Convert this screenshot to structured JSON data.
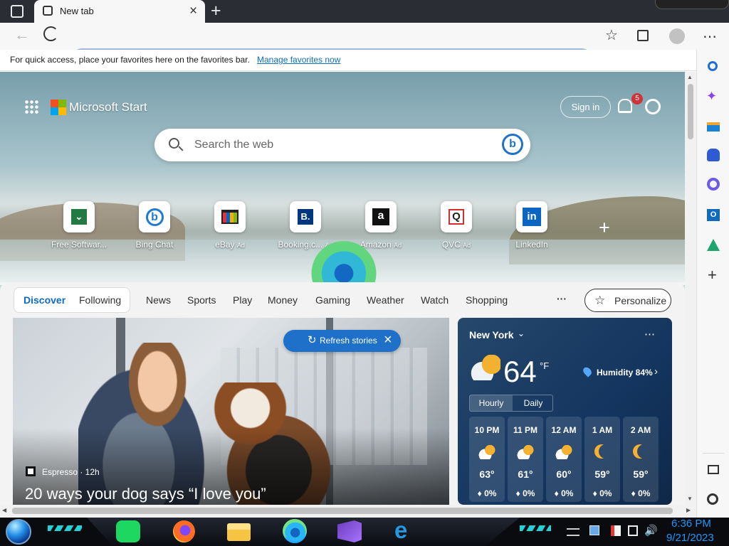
{
  "browser": {
    "tab_title": "New tab",
    "address_value": "",
    "favorites_message": "For quick access, place your favorites here on the favorites bar.",
    "manage_favorites": "Manage favorites now"
  },
  "start": {
    "brand": "Microsoft Start",
    "sign_in": "Sign in",
    "notifications": "5",
    "search_placeholder": "Search the web"
  },
  "shortcuts": [
    {
      "label": "Free Softwar...",
      "ad": "",
      "icon": "free-software-icon"
    },
    {
      "label": "Bing Chat",
      "ad": "",
      "icon": "bing-chat-icon"
    },
    {
      "label": "eBay",
      "ad": "Ad",
      "icon": "ebay-icon"
    },
    {
      "label": "Booking.c...",
      "ad": "Ad",
      "icon": "booking-icon"
    },
    {
      "label": "Amazon",
      "ad": "Ad",
      "icon": "amazon-icon"
    },
    {
      "label": "QVC",
      "ad": "Ad",
      "icon": "qvc-icon"
    },
    {
      "label": "LinkedIn",
      "ad": "",
      "icon": "linkedin-icon"
    }
  ],
  "feed_nav": {
    "discover": "Discover",
    "following": "Following",
    "items": [
      "News",
      "Sports",
      "Play",
      "Money",
      "Gaming",
      "Weather",
      "Watch",
      "Shopping"
    ],
    "more": "···",
    "personalize": "Personalize"
  },
  "story": {
    "refresh": "Refresh stories",
    "source": "Espresso · 12h",
    "headline": "20 ways your dog says “I love you”"
  },
  "weather": {
    "city": "New York",
    "temperature": "64",
    "unit": "°F",
    "humidity": "Humidity 84%",
    "tabs": [
      "Hourly",
      "Daily"
    ],
    "hours": [
      {
        "time": "10 PM",
        "temp": "63°",
        "precip": "0%"
      },
      {
        "time": "11 PM",
        "temp": "61°",
        "precip": "0%"
      },
      {
        "time": "12 AM",
        "temp": "60°",
        "precip": "0%"
      },
      {
        "time": "1 AM",
        "temp": "59°",
        "precip": "0%"
      },
      {
        "time": "2 AM",
        "temp": "59°",
        "precip": "0%"
      }
    ]
  },
  "taskbar": {
    "time": "6:36 PM",
    "date": "9/21/2023"
  },
  "colors": {
    "accent": "#0f6cbd",
    "notification": "#d13438",
    "weather_bg": "#17395d"
  }
}
